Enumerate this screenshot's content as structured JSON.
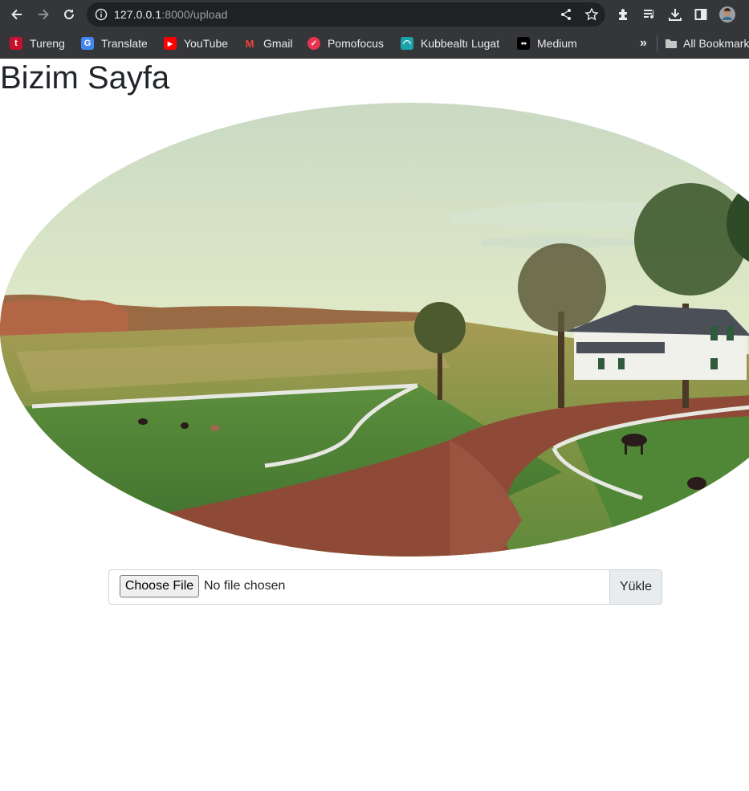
{
  "browser": {
    "url_host": "127.0.0.1",
    "url_rest": ":8000/upload",
    "bookmarks": [
      {
        "label": "Tureng",
        "icon": "tureng-icon",
        "glyph": "t",
        "color": "#c8102e"
      },
      {
        "label": "Translate",
        "icon": "google-translate-icon",
        "glyph": "G",
        "color": "#4285f4"
      },
      {
        "label": "YouTube",
        "icon": "youtube-icon",
        "glyph": "▶",
        "color": "#ff0000"
      },
      {
        "label": "Gmail",
        "icon": "gmail-icon",
        "glyph": "M",
        "color": "#ea4335"
      },
      {
        "label": "Pomofocus",
        "icon": "pomofocus-icon",
        "glyph": "✓",
        "color": "#e8344e"
      },
      {
        "label": "Kubbealtı Lugat",
        "icon": "kubbealti-icon",
        "glyph": "◠",
        "color": "#1aa3a8"
      },
      {
        "label": "Medium",
        "icon": "medium-icon",
        "glyph": "●●",
        "color": "#000000"
      }
    ],
    "overflow_label": "»",
    "all_bookmarks_label": "All Bookmarks"
  },
  "page": {
    "title": "Bizim Sayfa",
    "image_description_icon": "farm-landscape-image"
  },
  "upload": {
    "choose_label": "Choose File",
    "status": "No file chosen",
    "submit_label": "Yükle"
  }
}
